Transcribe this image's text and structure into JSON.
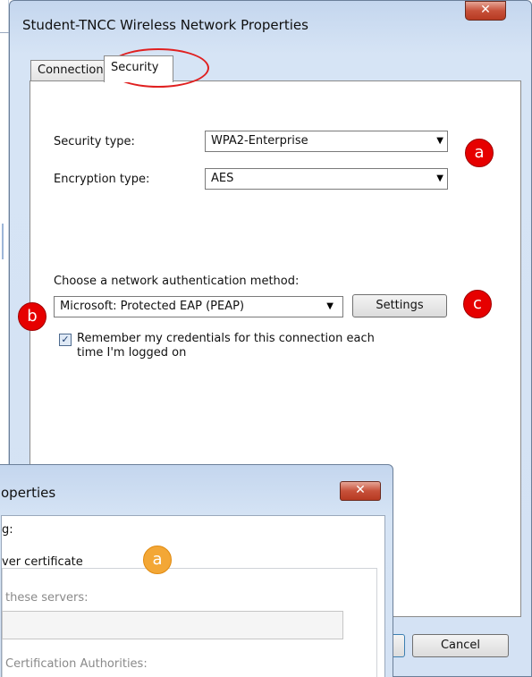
{
  "window": {
    "title": "Student-TNCC Wireless Network Properties",
    "close_glyph": "✕"
  },
  "tabs": [
    {
      "label": "Connection"
    },
    {
      "label": "Security"
    }
  ],
  "security": {
    "security_type_label": "Security type:",
    "security_type_value": "WPA2-Enterprise",
    "encryption_type_label": "Encryption type:",
    "encryption_type_value": "AES",
    "auth_method_label": "Choose a network authentication method:",
    "auth_method_value": "Microsoft: Protected EAP (PEAP)",
    "settings_label": "Settings",
    "remember_line1": "Remember my credentials for this connection each",
    "remember_line2": "time I'm logged on",
    "remember_checked": true
  },
  "footer": {
    "cancel_label": "Cancel"
  },
  "callouts": {
    "a": "a",
    "b": "b",
    "c": "c",
    "a2": "a"
  },
  "dialog2": {
    "title_partial": "operties",
    "line1": "g:",
    "line2": "ver certificate",
    "line3": "these servers:",
    "line4": "Certification Authorities:"
  },
  "colors": {
    "callout_red": "#e60000",
    "callout_orange": "#f3a736",
    "highlight_ring": "#e02020"
  }
}
